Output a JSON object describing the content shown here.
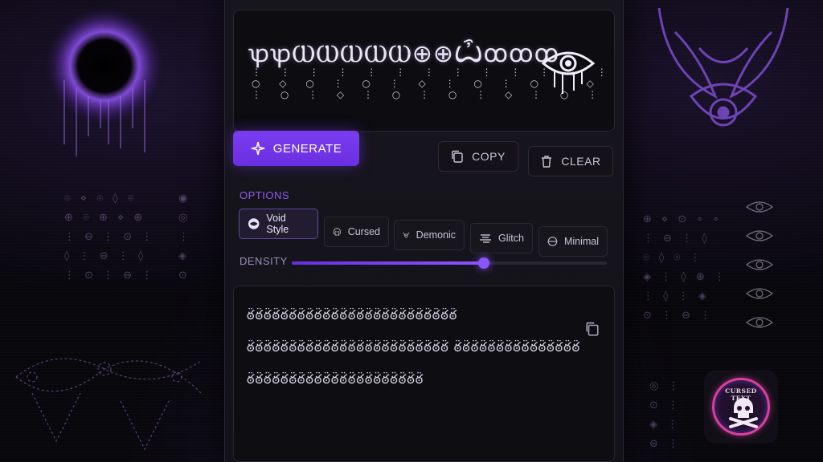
{
  "preview": {
    "text": "ꝕꝕⲰⲰⲰⲰⲰ⊕⊕Ѽꝏꝏꝏ",
    "drips": "⋮ ⋮ ⋮ ⋮ ⋮ ⋮ ⋮ ⋮ ⋮ ⋮ ⋮ ⋮ ⋮ ⋮ ⋮\n○ ◇ ○ ⋮ ○ ⋮ ◇ ⋮ ○ ⋮ ○ ⋮ ◇ ⋮ ○\n⋮ ○ ⋮ ◇ ⋮ ○ ⋮ ○ ⋮ ◇ ⋮ ○ ⋮ ○ ◉"
  },
  "buttons": {
    "generate": "GENERATE",
    "copy": "COPY",
    "clear": "CLEAR"
  },
  "options": {
    "label": "OPTIONS",
    "styles": [
      {
        "label": "Void Style",
        "icon": "void-icon",
        "active": true
      },
      {
        "label": "Cursed",
        "icon": "skull-icon",
        "active": false
      },
      {
        "label": "Demonic",
        "icon": "bull-skull-icon",
        "active": false
      },
      {
        "label": "Glitch",
        "icon": "glitch-icon",
        "active": false
      },
      {
        "label": "Minimal",
        "icon": "minimal-icon",
        "active": false
      }
    ]
  },
  "density": {
    "label": "DENSITY",
    "value": 0.61
  },
  "output": {
    "text": "ఠ̈ఠ̈ఠ̈ఠ̈ఠ̈ఠ̈ఠ̈ఠ̈ఠ̈ఠ̈ఠ̈ఠ̈ఠ̈ఠ̈ఠ̈ఠ̈ఠ̈ఠ̈ఠ̈ఠ̈ఠ̈ఠ̈ఠ̈ఠ̈ఠ̈ ఠ̈ఠ̈ఠ̈ఠ̈ఠ̈ఠ̈ఠ̈ఠ̈ఠ̈ఠ̈ఠ̈ఠ̈ఠ̈ఠ̈ఠ̈ఠ̈ఠ̈ఠ̈ఠ̈ఠ̈ఠ̈ఠ̈ఠ̈ఠ̈ ఠ̈ఠ̈ఠ̈ఠ̈ఠ̈ఠ̈ఠ̈ఠ̈ఠ̈ఠ̈ఠ̈ఠ̈ఠ̈ఠ̈ఠ̈ ఠ̈ఠ̈ఠ̈ఠ̈ఠ̈ఠ̈ఠ̈ఠ̈ఠ̈ఠ̈ఠ̈ఠ̈ఠ̈ఠ̈ఠ̈ఠ̈ఠ̈ఠ̈ఠ̈ఠ̈ఠ̈"
  },
  "badge": {
    "text": "CURSED TEXT"
  },
  "colors": {
    "accent": "#7a3df0",
    "badge_ring": "#d8409c"
  }
}
